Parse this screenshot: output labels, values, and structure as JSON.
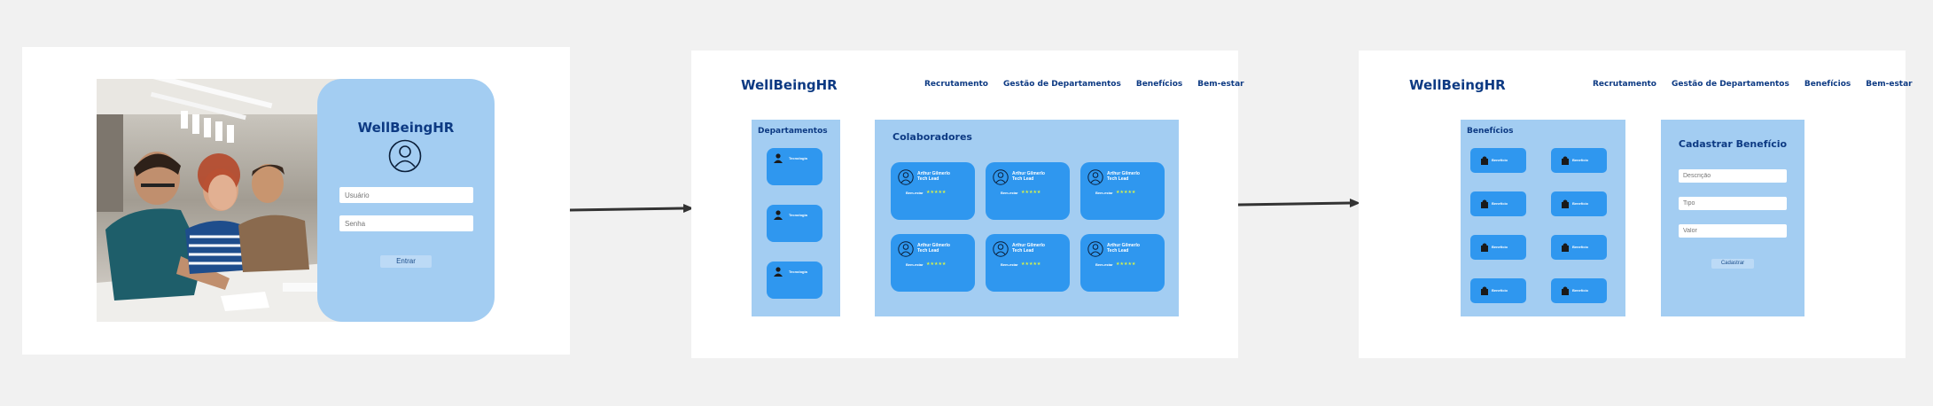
{
  "login": {
    "title": "WellBeingHR",
    "username_placeholder": "Usuário",
    "password_placeholder": "Senha",
    "submit_label": "Entrar"
  },
  "header": {
    "brand": "WellBeingHR",
    "nav": [
      "Recrutamento",
      "Gestão de Departamentos",
      "Benefícios",
      "Bem-estar"
    ]
  },
  "collaborators_screen": {
    "departments_title": "Departamentos",
    "department_label": "Tecnologia",
    "collaborators_title": "Colaboradores",
    "collaborator_name": "Arthur Gilmerlo",
    "collaborator_role": "Tech Lead",
    "wellbeing_label": "Bem-estar",
    "rating_stars": "★★★★★",
    "rating_value": 5
  },
  "benefits_screen": {
    "benefits_title": "Benefícios",
    "benefit_label": "Benefício",
    "form_title": "Cadastrar Benefício",
    "description_placeholder": "Descrição",
    "type_placeholder": "Tipo",
    "value_placeholder": "Valor",
    "submit_label": "Cadastrar"
  },
  "colors": {
    "background": "#f1f1f1",
    "frame": "#ffffff",
    "panel": "#a3cdf2",
    "card": "#2f97ef",
    "brand": "#0d3a83",
    "stars": "#d8f24a",
    "arrow": "#333333"
  }
}
